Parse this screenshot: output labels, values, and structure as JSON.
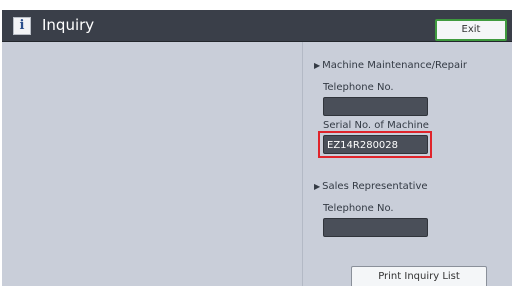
{
  "window": {
    "title": "Inquiry",
    "info_icon": "i",
    "exit_label": "Exit"
  },
  "maintenance": {
    "heading": "Machine Maintenance/Repair",
    "telephone_label": "Telephone No.",
    "telephone_value": "",
    "serial_label": "Serial No. of Machine",
    "serial_value": "EZ14R280028"
  },
  "sales": {
    "heading": "Sales Representative",
    "telephone_label": "Telephone No.",
    "telephone_value": ""
  },
  "actions": {
    "print_label": "Print Inquiry List"
  },
  "colors": {
    "titlebar": "#3a3f49",
    "panel": "#c9ced9",
    "field": "#4a4f59",
    "exit_border": "#3f9a3f",
    "highlight": "#e0242b"
  }
}
